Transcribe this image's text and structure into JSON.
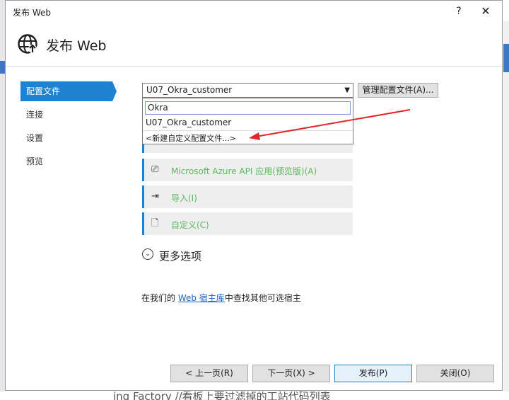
{
  "window": {
    "title": "发布 Web",
    "help_glyph": "?",
    "close_glyph": "✕"
  },
  "header": {
    "title": "发布 Web"
  },
  "nav": [
    {
      "label": "配置文件",
      "active": true
    },
    {
      "label": "连接",
      "active": false
    },
    {
      "label": "设置",
      "active": false
    },
    {
      "label": "预览",
      "active": false
    }
  ],
  "profile": {
    "selected": "U07_Okra_customer",
    "manage_label": "管理配置文件(A)...",
    "dropdown": {
      "filter_value": "Okra",
      "items": [
        "U07_Okra_customer",
        "<新建自定义配置文件...>"
      ]
    }
  },
  "targets": [
    {
      "label": "Microsoft Azure API 应用(预览版)(A)",
      "icon": "azure-api-icon"
    },
    {
      "label": "导入(I)",
      "icon": "import-icon"
    },
    {
      "label": "自定义(C)",
      "icon": "custom-file-icon"
    }
  ],
  "more_options": {
    "label": "更多选项"
  },
  "find_hosts": {
    "prefix": "在我们的 ",
    "link": "Web 宿主库",
    "suffix": "中查找其他可选宿主"
  },
  "footer": {
    "prev": "< 上一页(R)",
    "next": "下一页(X) >",
    "publish": "发布(P)",
    "close": "关闭(O)"
  },
  "background": {
    "code_snippet": "ing   Factory  //看板上要过滤掉的工站代码列表"
  },
  "colors": {
    "accent": "#1e82d2",
    "tile_label": "#5bb85b",
    "annotation": "#e3262b"
  }
}
